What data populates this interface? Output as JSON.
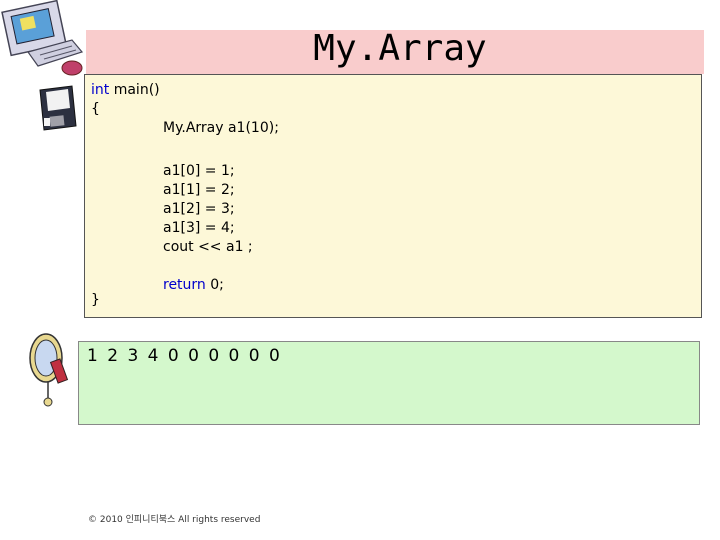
{
  "slide": {
    "title": "My.Array",
    "code": {
      "line1_kw": "int",
      "line1_rest": " main()",
      "line2": "{",
      "line3": "My.Array a1(10);",
      "line4": "a1[0] = 1;",
      "line5": "a1[1] = 2;",
      "line6": "a1[2] = 3;",
      "line7": "a1[3] = 4;",
      "line8": "cout << a1 ;",
      "line9_kw": "return",
      "line9_rest": " 0;",
      "line10": "}"
    },
    "output": "1 2 3 4 0 0 0 0 0 0",
    "copyright": "© 2010 인피니티북스  All rights reserved"
  },
  "colors": {
    "title_bar": "#f9cccc",
    "code_bg": "#fdf8d8",
    "output_bg": "#d4f8cc",
    "keyword": "#0000cc"
  },
  "icons": [
    "computer-icon",
    "floppy-disk-icon",
    "monitor-icon"
  ]
}
